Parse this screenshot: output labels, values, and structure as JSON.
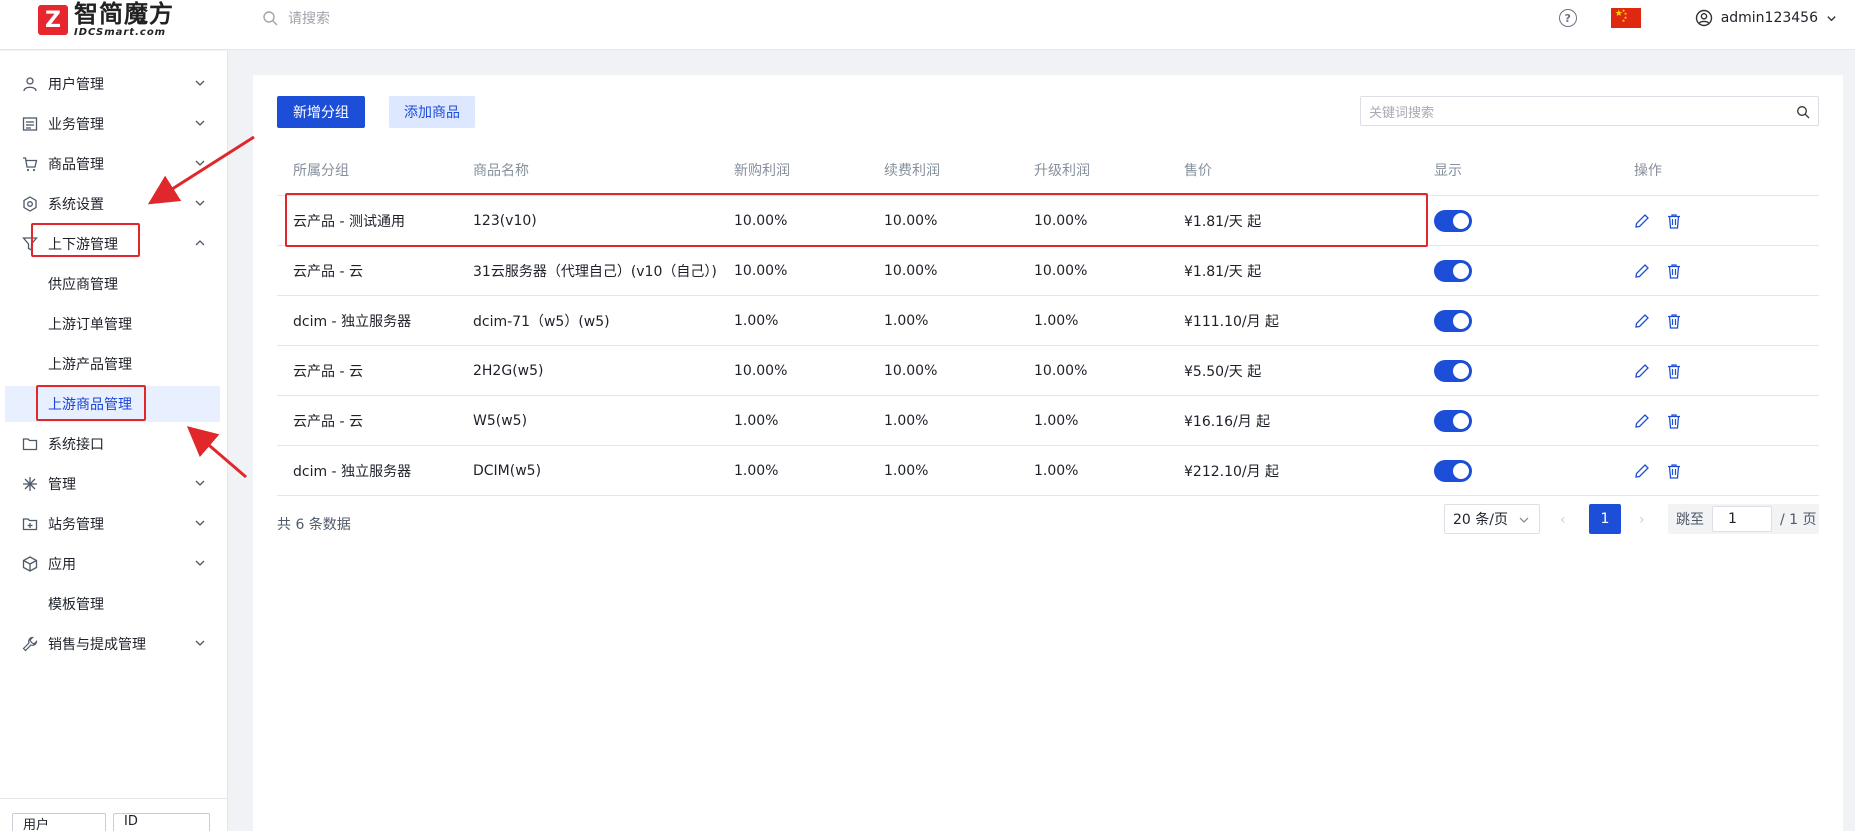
{
  "header": {
    "logo_cn": "智简魔方",
    "logo_en": "IDCSmart.com",
    "search_placeholder": "请搜索",
    "username": "admin123456"
  },
  "sidebar": {
    "items": [
      {
        "label": "用户管理",
        "icon": "user-icon",
        "chevron": "down"
      },
      {
        "label": "业务管理",
        "icon": "list-icon",
        "chevron": "down"
      },
      {
        "label": "商品管理",
        "icon": "cart-icon",
        "chevron": "down"
      },
      {
        "label": "系统设置",
        "icon": "settings-icon",
        "chevron": "down"
      },
      {
        "label": "上下游管理",
        "icon": "funnel-icon",
        "chevron": "up"
      },
      {
        "label": "系统接口",
        "icon": "folder-icon",
        "chevron": "none"
      },
      {
        "label": "管理",
        "icon": "sparkle-icon",
        "chevron": "down"
      },
      {
        "label": "站务管理",
        "icon": "folder-plus-icon",
        "chevron": "down"
      },
      {
        "label": "应用",
        "icon": "cube-icon",
        "chevron": "down"
      },
      {
        "label": "销售与提成管理",
        "icon": "wrench-icon",
        "chevron": "down"
      }
    ],
    "sub_items": [
      "供应商管理",
      "上游订单管理",
      "上游产品管理",
      "上游商品管理"
    ],
    "plain_item": "模板管理",
    "bottom_select_1": "用户",
    "bottom_select_2": "ID"
  },
  "toolbar": {
    "add_group_label": "新增分组",
    "add_product_label": "添加商品",
    "keyword_placeholder": "关键词搜索"
  },
  "table": {
    "headers": [
      "所属分组",
      "商品名称",
      "新购利润",
      "续费利润",
      "升级利润",
      "售价",
      "显示",
      "操作"
    ],
    "rows": [
      {
        "group": "云产品 - 测试通用",
        "name": "123(v10)",
        "new": "10.00%",
        "renew": "10.00%",
        "upgrade": "10.00%",
        "price": "¥1.81/天 起",
        "visible": true
      },
      {
        "group": "云产品 - 云",
        "name": "31云服务器（代理自己）(v10（自己）)",
        "new": "10.00%",
        "renew": "10.00%",
        "upgrade": "10.00%",
        "price": "¥1.81/天 起",
        "visible": true
      },
      {
        "group": "dcim - 独立服务器",
        "name": "dcim-71（w5）(w5)",
        "new": "1.00%",
        "renew": "1.00%",
        "upgrade": "1.00%",
        "price": "¥111.10/月 起",
        "visible": true
      },
      {
        "group": "云产品 - 云",
        "name": "2H2G(w5)",
        "new": "10.00%",
        "renew": "10.00%",
        "upgrade": "10.00%",
        "price": "¥5.50/天 起",
        "visible": true
      },
      {
        "group": "云产品 - 云",
        "name": "W5(w5)",
        "new": "1.00%",
        "renew": "1.00%",
        "upgrade": "1.00%",
        "price": "¥16.16/月 起",
        "visible": true
      },
      {
        "group": "dcim - 独立服务器",
        "name": "DCIM(w5)",
        "new": "1.00%",
        "renew": "1.00%",
        "upgrade": "1.00%",
        "price": "¥212.10/月 起",
        "visible": true
      }
    ]
  },
  "pagination": {
    "total": "共 6 条数据",
    "page_size": "20 条/页",
    "current_page": "1",
    "jump_label": "跳至",
    "jump_value": "1",
    "total_pages": "/ 1 页"
  },
  "colors": {
    "primary": "#1d4ed8",
    "annotation_red": "#e0272c"
  }
}
